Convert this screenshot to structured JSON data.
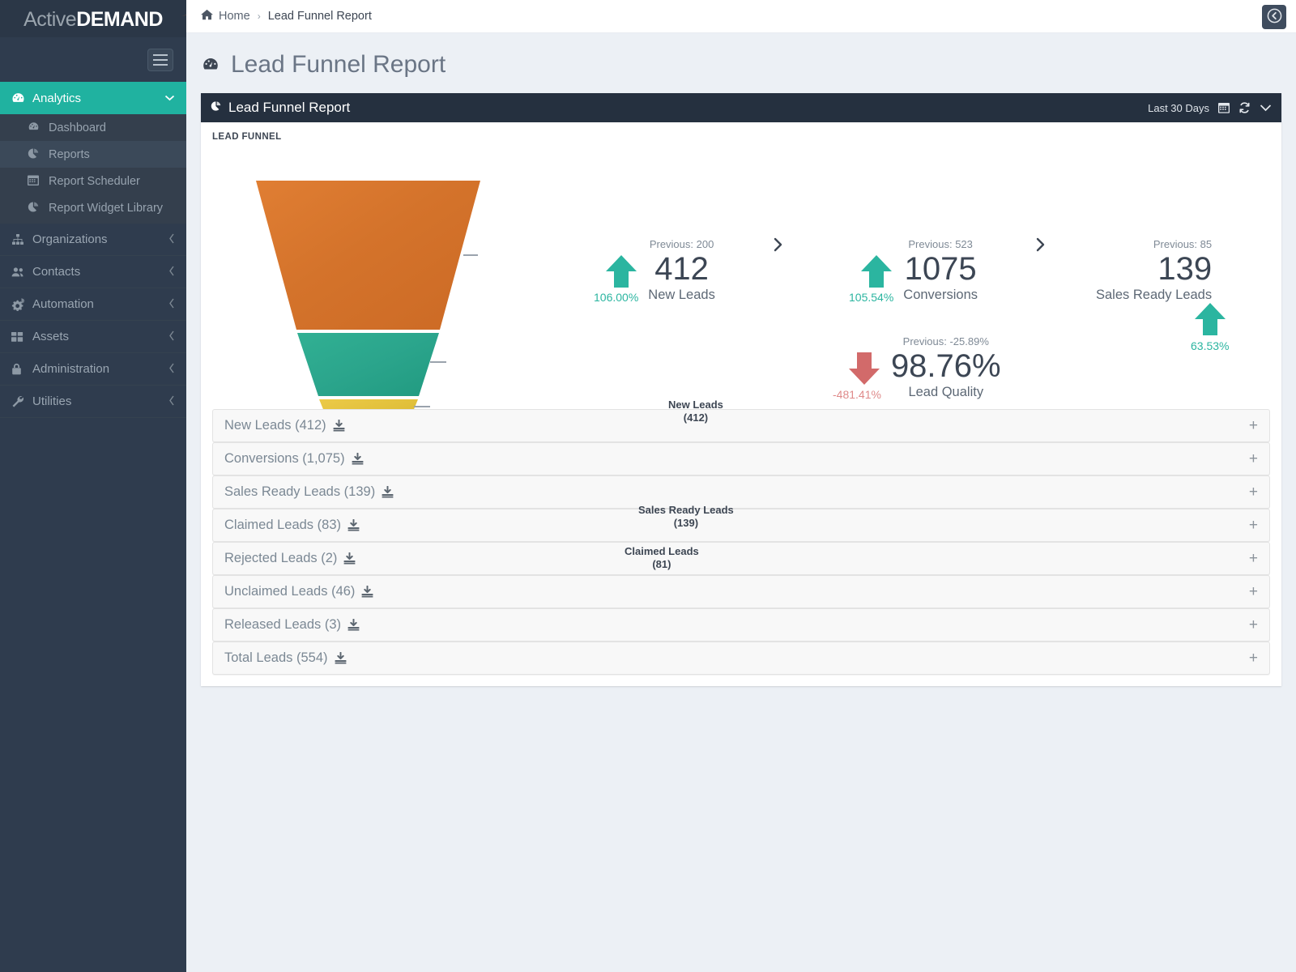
{
  "brand": {
    "part1": "Active",
    "part2": "DEMAND"
  },
  "sidebar": {
    "menu": [
      {
        "label": "Analytics",
        "icon": "dashboard-icon",
        "active": true,
        "caret": "⌄"
      },
      {
        "label": "Organizations",
        "icon": "sitemap-icon",
        "active": false,
        "caret": "‹"
      },
      {
        "label": "Contacts",
        "icon": "users-icon",
        "active": false,
        "caret": "‹"
      },
      {
        "label": "Automation",
        "icon": "cogs-icon",
        "active": false,
        "caret": "‹"
      },
      {
        "label": "Assets",
        "icon": "grid-icon",
        "active": false,
        "caret": "‹"
      },
      {
        "label": "Administration",
        "icon": "lock-icon",
        "active": false,
        "caret": "‹"
      },
      {
        "label": "Utilities",
        "icon": "wrench-icon",
        "active": false,
        "caret": "‹"
      }
    ],
    "submenu": [
      {
        "label": "Dashboard",
        "icon": "dashboard-icon",
        "selected": false
      },
      {
        "label": "Reports",
        "icon": "pie-chart-icon",
        "selected": true
      },
      {
        "label": "Report Scheduler",
        "icon": "calendar-icon",
        "selected": false
      },
      {
        "label": "Report Widget Library",
        "icon": "pie-chart-icon",
        "selected": false
      }
    ]
  },
  "breadcrumb": {
    "home": "Home",
    "separator": "›",
    "current": "Lead Funnel Report"
  },
  "page": {
    "title": "Lead Funnel Report"
  },
  "panel": {
    "title": "Lead Funnel Report",
    "date_range": "Last 30 Days",
    "section_caption": "LEAD FUNNEL"
  },
  "chart_data": {
    "type": "funnel",
    "title": "LEAD FUNNEL",
    "stages": [
      {
        "label": "New Leads",
        "value": 412,
        "value_text": "(412)",
        "color": "#d2722c"
      },
      {
        "label": "Sales Ready Leads",
        "value": 139,
        "value_text": "(139)",
        "color": "#2ba58c"
      },
      {
        "label": "Claimed Leads",
        "value": 81,
        "value_text": "(81)",
        "color": "#e2c13e"
      }
    ]
  },
  "kpis": [
    {
      "id": "new-leads",
      "previous_label": "Previous: 200",
      "value": "412",
      "label": "New Leads",
      "change": "106.00%",
      "direction": "up"
    },
    {
      "id": "conversions",
      "previous_label": "Previous: 523",
      "value": "1075",
      "label": "Conversions",
      "change": "105.54%",
      "direction": "up"
    },
    {
      "id": "sales-ready-leads",
      "previous_label": "Previous: 85",
      "value": "139",
      "label": "Sales Ready Leads",
      "change": "63.53%",
      "direction": "up"
    },
    {
      "id": "lead-quality",
      "previous_label": "Previous: -25.89%",
      "value": "98.76%",
      "label": "Lead Quality",
      "change": "-481.41%",
      "direction": "down"
    }
  ],
  "accordion": [
    {
      "label": "New Leads (412)",
      "expander": "+"
    },
    {
      "label": "Conversions (1,075)",
      "expander": "+"
    },
    {
      "label": "Sales Ready Leads (139)",
      "expander": "+"
    },
    {
      "label": "Claimed Leads (83)",
      "expander": "+"
    },
    {
      "label": "Rejected Leads (2)",
      "expander": "+"
    },
    {
      "label": "Unclaimed Leads (46)",
      "expander": "+"
    },
    {
      "label": "Released Leads (3)",
      "expander": "+"
    },
    {
      "label": "Total Leads (554)",
      "expander": "+"
    }
  ],
  "colors": {
    "sidebar_bg": "#2f3c4e",
    "accent_teal": "#20b2a0",
    "panel_header": "#25303f",
    "up_green": "#2bb5a0",
    "down_red": "#d26a6a",
    "funnel_orange": "#d2722c",
    "funnel_teal": "#2ba58c",
    "funnel_yellow": "#e2c13e"
  }
}
